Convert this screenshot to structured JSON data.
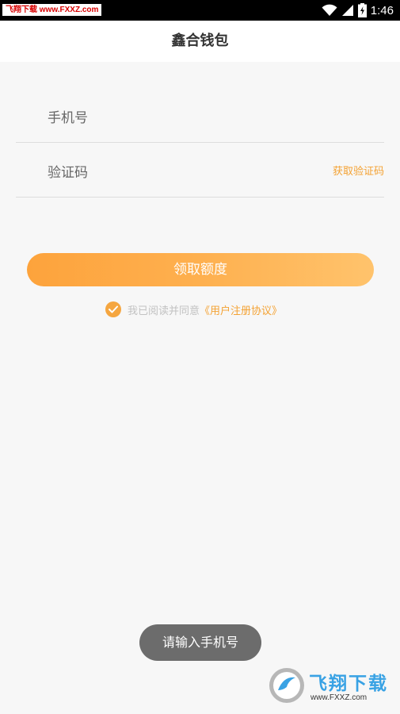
{
  "status_bar": {
    "watermark": "飞翔下载 www.FXXZ.com",
    "time": "1:46"
  },
  "header": {
    "title": "鑫合钱包"
  },
  "form": {
    "phone": {
      "placeholder": "手机号",
      "value": ""
    },
    "code": {
      "placeholder": "验证码",
      "value": "",
      "get_code_label": "获取验证码"
    }
  },
  "submit_label": "领取额度",
  "agreement": {
    "checked": true,
    "text": "我已阅读并同意",
    "link": "《用户注册协议》"
  },
  "toast": "请输入手机号",
  "watermark_bottom": {
    "text": "飞翔下载",
    "url": "www.FXXZ.com"
  },
  "colors": {
    "accent": "#f4a233",
    "button_gradient_start": "#fda33c",
    "button_gradient_end": "#ffc36c",
    "toast_bg": "#6c6c6c"
  }
}
